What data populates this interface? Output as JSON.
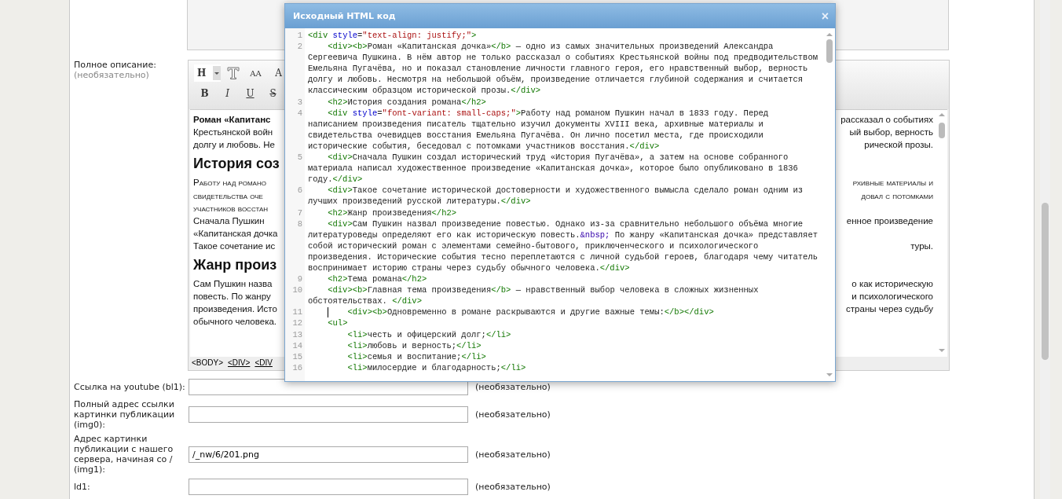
{
  "editor_field": {
    "label": "Полное описание:",
    "hint": "(необязательно)",
    "toolbar": [
      [
        {
          "kind": "heading",
          "label": "H"
        },
        {
          "kind": "clear"
        },
        {
          "kind": "smallcaps",
          "label": "AA"
        },
        {
          "kind": "case",
          "label": "A"
        }
      ],
      [
        {
          "kind": "bold",
          "label": "B"
        },
        {
          "kind": "italic",
          "label": "I"
        },
        {
          "kind": "underline",
          "label": "U"
        },
        {
          "kind": "strike",
          "label": "S"
        }
      ]
    ],
    "rows": [
      {
        "kind": "lead",
        "left": "Роман «Капитанс",
        "right": "рассказал о событиях"
      },
      {
        "kind": "text",
        "left": "Крестьянской войн",
        "right": "ый выбор, верность"
      },
      {
        "kind": "text",
        "left": "долгу и любовь. Не",
        "right": "рической прозы."
      },
      {
        "kind": "heading",
        "left": "История соз"
      },
      {
        "kind": "smallcaps",
        "left": "Работу над романо",
        "right": "рхивные материалы и"
      },
      {
        "kind": "smallcaps",
        "left": "свидетельства оче",
        "right": "довал с потомками"
      },
      {
        "kind": "smallcaps",
        "left": "участников восстан"
      },
      {
        "kind": "text",
        "left": "Сначала Пушкин",
        "right": "енное произведение"
      },
      {
        "kind": "text",
        "left": "«Капитанская дочка"
      },
      {
        "kind": "text",
        "left": "Такое сочетание ис",
        "right": "туры."
      },
      {
        "kind": "heading",
        "left": "Жанр произ"
      },
      {
        "kind": "text",
        "left": "Сам Пушкин назва",
        "right": "о как историческую"
      },
      {
        "kind": "text",
        "left": "повесть.  По жанру",
        "right": "и психологического"
      },
      {
        "kind": "text",
        "left": "произведения. Исто",
        "right": "страны через судьбу"
      },
      {
        "kind": "text",
        "left": "обычного человека."
      }
    ],
    "path": [
      {
        "label": "<BODY>",
        "underlined": false
      },
      {
        "label": "<DIV>",
        "underlined": true
      },
      {
        "label": "<DIV",
        "underlined": true
      }
    ]
  },
  "fields": [
    {
      "label": "Ссылка на youtube (bl1):",
      "hint": "(необязательно)"
    },
    {
      "label": "Полный адрес ссылки картинки публикации (img0):",
      "hint": "(необязательно)"
    },
    {
      "label": "Адрес картинки публикации с нашего сервера, начиная со / (img1):",
      "value": "/_nw/6/201.png",
      "hint": "(необязательно)"
    },
    {
      "label": "ld1:",
      "hint": "(необязательно)"
    }
  ],
  "dialog": {
    "title": "Исходный HTML код",
    "close": "×",
    "lines": [
      {
        "number": "1",
        "cursor": false,
        "code": "<div style=\"text-align: justify;\">"
      },
      {
        "number": "2",
        "cursor": false,
        "code": "    <div><b>Роман «Капитанская дочка»</b> — одно из самых значительных произведений Александра Сергеевича Пушкина. В нём автор не только рассказал о событиях Крестьянской войны под предводительством Емельяна Пугачёва, но и показал становление личности главного героя, его нравственный выбор, верность долгу и любовь. Несмотря на небольшой объём, произведение отличается глубиной содержания и считается классическим образцом исторической прозы.</div>"
      },
      {
        "number": "3",
        "cursor": false,
        "code": "    <h2>История создания романа</h2>"
      },
      {
        "number": "4",
        "cursor": false,
        "code": "    <div style=\"font-variant: small-caps;\">Работу над романом Пушкин начал в 1833 году. Перед написанием произведения писатель тщательно изучил документы XVIII века, архивные материалы и свидетельства очевидцев восстания Емельяна Пугачёва. Он лично посетил места, где происходили исторические события, беседовал с потомками участников восстания.</div>"
      },
      {
        "number": "5",
        "cursor": false,
        "code": "    <div>Сначала Пушкин создал исторический труд «История Пугачёва», а затем на основе собранного материала написал художественное произведение «Капитанская дочка», которое было опубликовано в 1836 году.</div>"
      },
      {
        "number": "6",
        "cursor": false,
        "code": "    <div>Такое сочетание исторической достоверности и художественного вымысла сделало роман одним из лучших произведений русской литературы.</div>"
      },
      {
        "number": "7",
        "cursor": false,
        "code": "    <h2>Жанр произведения</h2>"
      },
      {
        "number": "8",
        "cursor": false,
        "code": "    <div>Сам Пушкин назвал произведение повестью. Однако из-за сравнительно небольшого объёма многие литературоведы определяют его как историческую повесть.&nbsp; По жанру «Капитанская дочка» представляет собой исторический роман с элементами семейно-бытового, приключенческого и психологического произведения. Исторические события тесно переплетаются с личной судьбой героев, благодаря чему читатель воспринимает историю страны через судьбу обычного человека.</div>"
      },
      {
        "number": "9",
        "cursor": false,
        "code": "    <h2>Тема романа</h2>"
      },
      {
        "number": "10",
        "cursor": false,
        "code": "    <div><b>Главная тема произведения</b> — нравственный выбор человека в сложных жизненных обстоятельствах. </div>"
      },
      {
        "number": "11",
        "cursor": true,
        "code": "        <div><b>Одновременно в романе раскрываются и другие важные темы:</b></div>"
      },
      {
        "number": "12",
        "cursor": false,
        "code": "    <ul>"
      },
      {
        "number": "13",
        "cursor": false,
        "code": "        <li>честь и офицерский долг;</li>"
      },
      {
        "number": "14",
        "cursor": false,
        "code": "        <li>любовь и верность;</li>"
      },
      {
        "number": "15",
        "cursor": false,
        "code": "        <li>семья и воспитание;</li>"
      },
      {
        "number": "16",
        "cursor": false,
        "code": "        <li>милосердие и благодарность;</li>"
      }
    ]
  }
}
